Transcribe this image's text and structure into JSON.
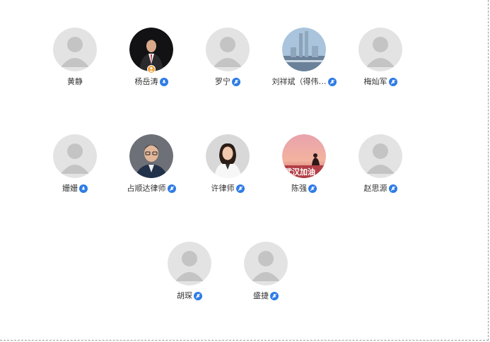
{
  "participants": [
    {
      "name": "黄静",
      "avatar": "default-avatar",
      "mic": "none",
      "host": false
    },
    {
      "name": "杨岳涛",
      "avatar": "photo-man-in-suit",
      "mic": "mic-on-icon",
      "host": true
    },
    {
      "name": "罗宁",
      "avatar": "default-avatar",
      "mic": "mic-muted-icon",
      "host": false
    },
    {
      "name": "刘祥斌（得伟…",
      "avatar": "photo-city-skyline",
      "mic": "mic-muted-icon",
      "host": false
    },
    {
      "name": "梅灿军",
      "avatar": "default-avatar",
      "mic": "mic-muted-icon",
      "host": false
    },
    {
      "name": "姗姗",
      "avatar": "default-avatar",
      "mic": "mic-on-icon",
      "host": false
    },
    {
      "name": "占顺达律师",
      "avatar": "photo-man-glasses",
      "mic": "mic-muted-icon",
      "host": false
    },
    {
      "name": "许律师",
      "avatar": "photo-woman-white-suit",
      "mic": "mic-muted-icon",
      "host": false
    },
    {
      "name": "陈强",
      "avatar": "photo-sunset-wuhan",
      "mic": "mic-muted-icon",
      "host": false
    },
    {
      "name": "赵思源",
      "avatar": "default-avatar",
      "mic": "mic-muted-icon",
      "host": false
    },
    {
      "name": "胡琛",
      "avatar": "default-avatar",
      "mic": "mic-muted-icon",
      "host": false
    },
    {
      "name": "盛捷",
      "avatar": "default-avatar",
      "mic": "mic-muted-icon",
      "host": false
    }
  ],
  "sunset_photo_text": "武汉加油",
  "colors": {
    "mic_blue": "#2e7be6",
    "host_badge": "#f2a33a",
    "default_avatar_bg": "#e3e3e3",
    "default_avatar_fg": "#c4c4c4"
  }
}
